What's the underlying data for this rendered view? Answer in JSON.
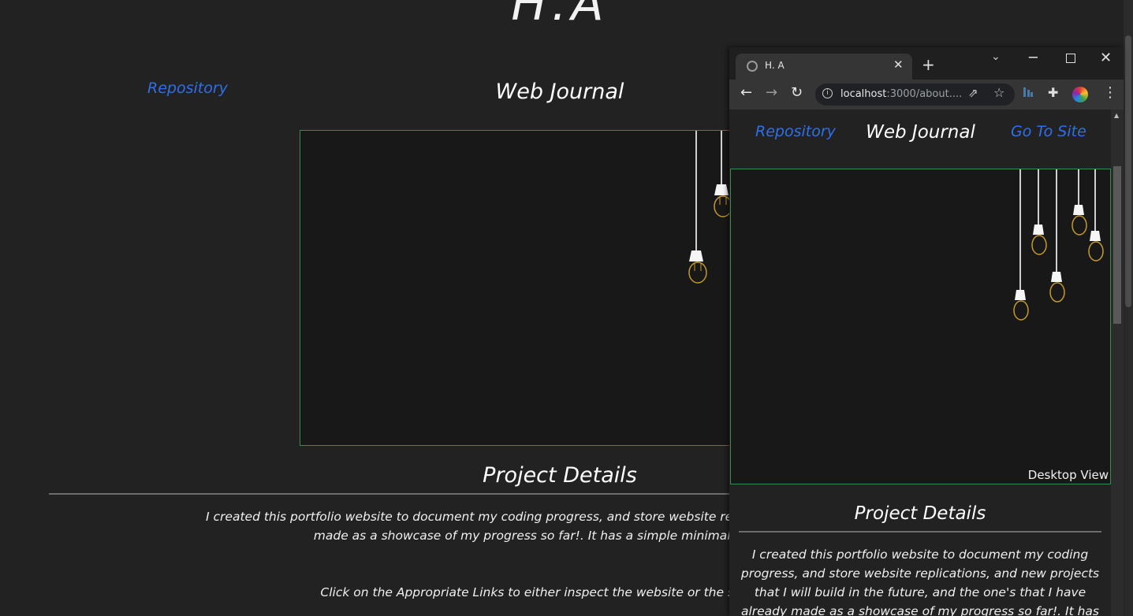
{
  "background_page": {
    "logo": "H.A",
    "repository_link": "Repository",
    "title": "Web Journal",
    "section_title": "Project Details",
    "description_line1": "I created this portfolio website to document my coding progress, and store website replications, and new projects that",
    "description_line2": "made as a showcase of my progress so far!. It has a simple minimalistic design aes",
    "instruction": "Click on the Appropriate Links to either inspect the website or the source code at"
  },
  "browser": {
    "tab": {
      "title": "H. A",
      "close_glyph": "✕"
    },
    "new_tab_glyph": "+",
    "tab_list_glyph": "⌄",
    "window": {
      "minimize_glyph": "─",
      "close_glyph": "✕"
    },
    "nav": {
      "back_glyph": "←",
      "forward_glyph": "→",
      "reload_glyph": "↻"
    },
    "address": {
      "host": "localhost",
      "rest": ":3000/about...."
    },
    "share_glyph": "⇗",
    "star_glyph": "☆",
    "puzzle_glyph": "✚",
    "menu_glyph": "⋮",
    "info_glyph": "i"
  },
  "popup_page": {
    "repository_link": "Repository",
    "title": "Web Journal",
    "go_to_site_link": "Go To Site",
    "preview_caption": "Desktop View",
    "section_title": "Project Details",
    "description": "I created this portfolio website to document my coding progress, and store website replications, and new projects that I will build in the future, and the one's that I have already made as a showcase of my progress so far!. It has a"
  },
  "colors": {
    "accent_link": "#2f6fe8",
    "preview_border": "#3a8a4e",
    "bulb": "#c49a2a"
  },
  "icons": [
    "globe-icon",
    "close-icon",
    "plus-icon",
    "chevron-down-icon",
    "minimize-icon",
    "maximize-icon",
    "arrow-left-icon",
    "arrow-right-icon",
    "reload-icon",
    "info-icon",
    "share-icon",
    "star-icon",
    "extension-icon",
    "puzzle-icon",
    "avatar",
    "kebab-menu-icon"
  ]
}
